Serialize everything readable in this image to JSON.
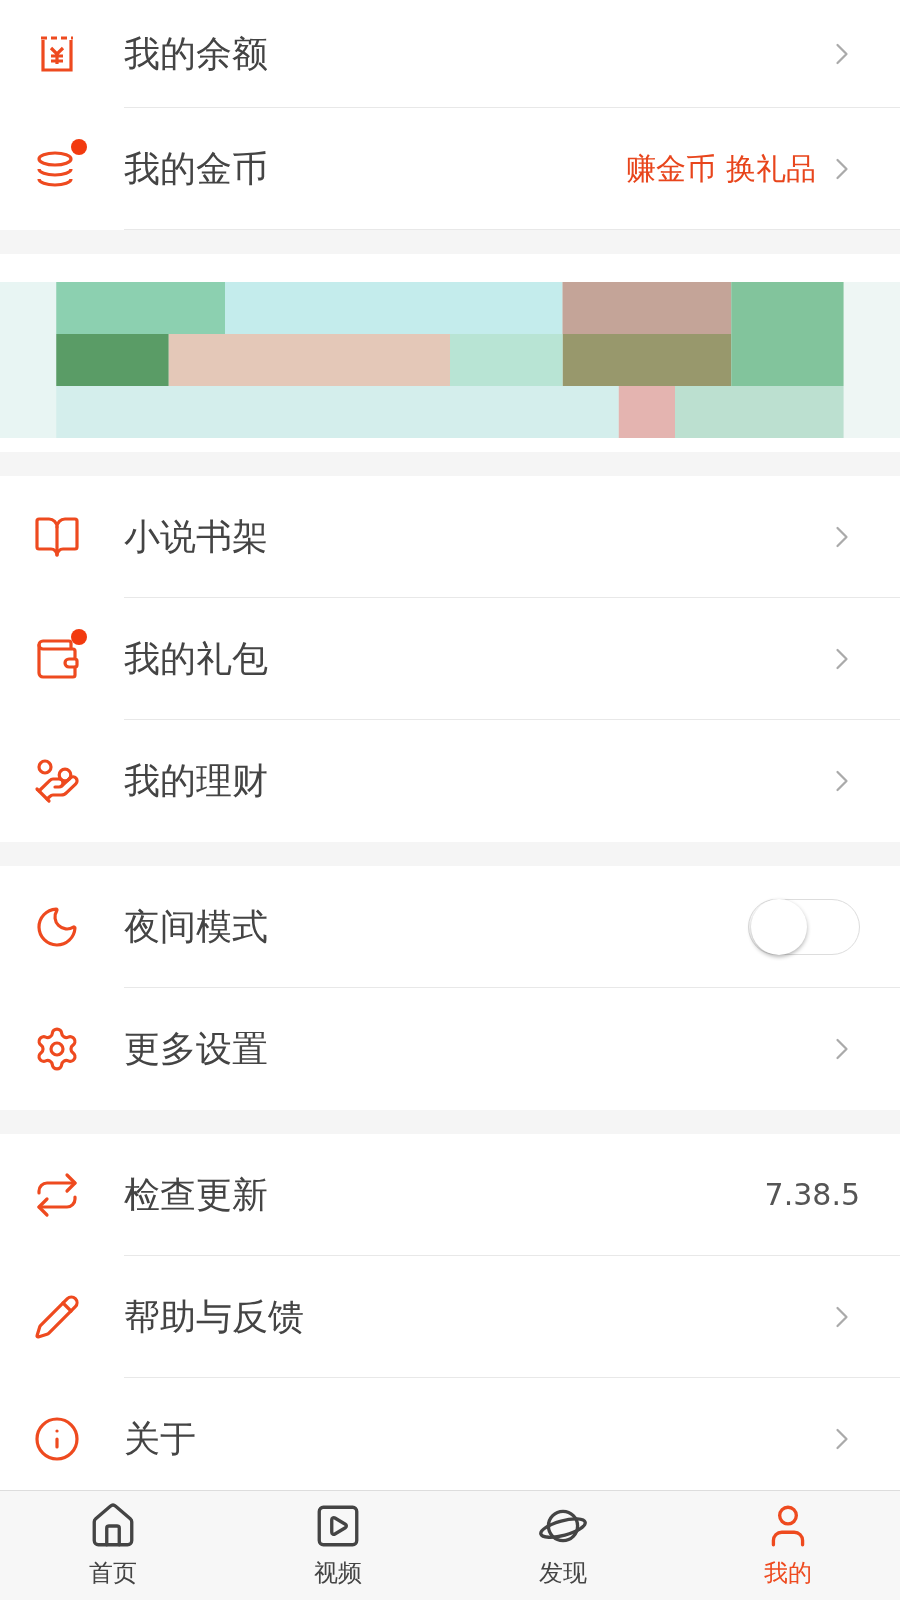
{
  "sections": [
    {
      "kind": "menu",
      "rows": [
        {
          "label": "我的余额",
          "kind": "chevron",
          "badge": false
        },
        {
          "label": "我的金币",
          "kind": "chevron",
          "badge": true,
          "promo": "赚金币 换礼品"
        }
      ]
    },
    {
      "kind": "banner"
    },
    {
      "kind": "menu",
      "rows": [
        {
          "label": "小说书架",
          "kind": "chevron",
          "badge": false
        },
        {
          "label": "我的礼包",
          "kind": "chevron",
          "badge": true
        },
        {
          "label": "我的理财",
          "kind": "chevron",
          "badge": false
        }
      ]
    },
    {
      "kind": "menu",
      "rows": [
        {
          "label": "夜间模式",
          "kind": "toggle",
          "on": false
        },
        {
          "label": "更多设置",
          "kind": "chevron",
          "badge": false
        }
      ]
    },
    {
      "kind": "menu",
      "rows": [
        {
          "label": "检查更新",
          "kind": "value",
          "value": "7.38.5"
        },
        {
          "label": "帮助与反馈",
          "kind": "chevron",
          "badge": false
        },
        {
          "label": "关于",
          "kind": "chevron",
          "badge": false
        }
      ]
    }
  ],
  "tab_bar": [
    {
      "label": "首页",
      "selected": false
    },
    {
      "label": "视频",
      "selected": false
    },
    {
      "label": "发现",
      "selected": false
    },
    {
      "label": "我的",
      "selected": true
    }
  ]
}
